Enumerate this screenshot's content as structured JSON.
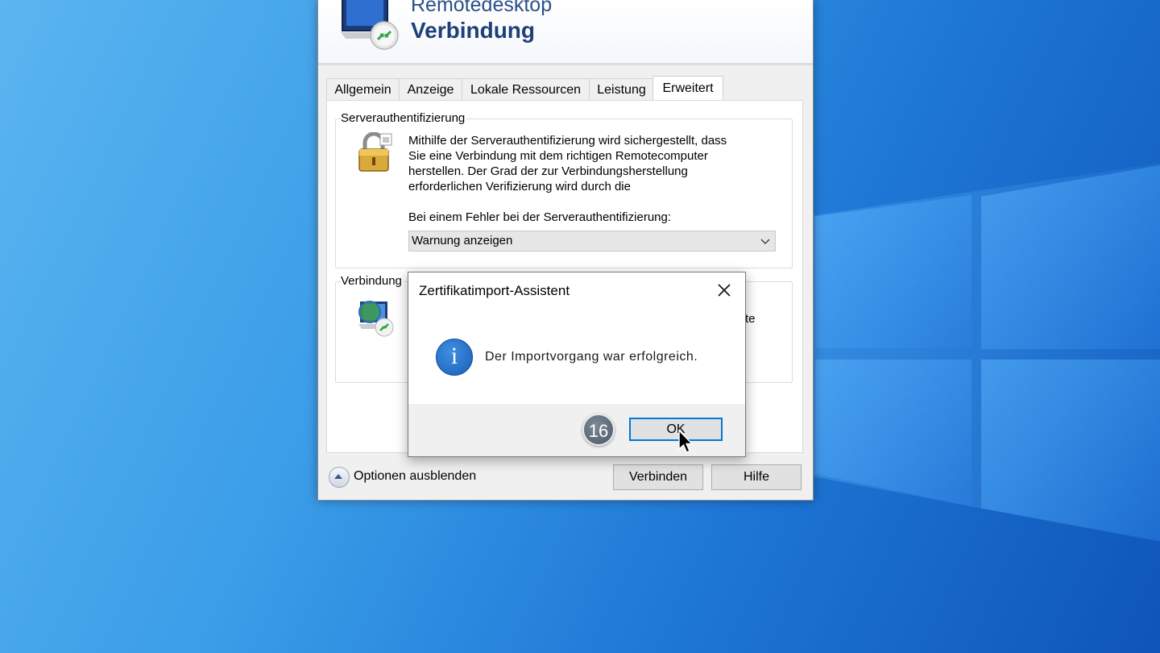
{
  "rdp_window": {
    "banner_line1": "Remotedesktop",
    "banner_line2": "Verbindung",
    "tabs": [
      {
        "label": "Allgemein"
      },
      {
        "label": "Anzeige"
      },
      {
        "label": "Lokale Ressourcen"
      },
      {
        "label": "Leistung"
      },
      {
        "label": "Erweitert",
        "active": true
      }
    ],
    "server_auth": {
      "title": "Serverauthentifizierung",
      "description_lines": [
        "Mithilfe der Serverauthentifizierung wird sichergestellt, dass",
        "Sie eine Verbindung mit dem richtigen Remotecomputer",
        "herstellen. Der Grad der zur Verbindungsherstellung",
        "erforderlichen Verifizierung wird durch die"
      ],
      "error_label": "Bei einem Fehler bei der Serverauthentifizierung:",
      "error_select_value": "Warnung anzeigen"
    },
    "connection_group": {
      "title": "Verbindung",
      "partial_text": "te"
    },
    "options_label": "Optionen ausblenden",
    "connect_button": "Verbinden",
    "help_button": "Hilfe"
  },
  "dialog": {
    "title": "Zertifikatimport-Assistent",
    "message": "Der Importvorgang war erfolgreich.",
    "ok_button": "OK",
    "info_glyph": "i"
  },
  "step_badge": "16",
  "icons": {
    "banner": "remote-desktop-monitor-icon",
    "server_auth": "padlock-icon",
    "connection": "globe-network-icon",
    "dialog_info": "info-icon",
    "close": "close-icon",
    "options": "chevron-up-icon",
    "cursor": "mouse-pointer-icon"
  },
  "colors": {
    "accent": "#0078d7",
    "banner_text": "#1f3f7a",
    "desktop_blue": "#1f78d6"
  }
}
